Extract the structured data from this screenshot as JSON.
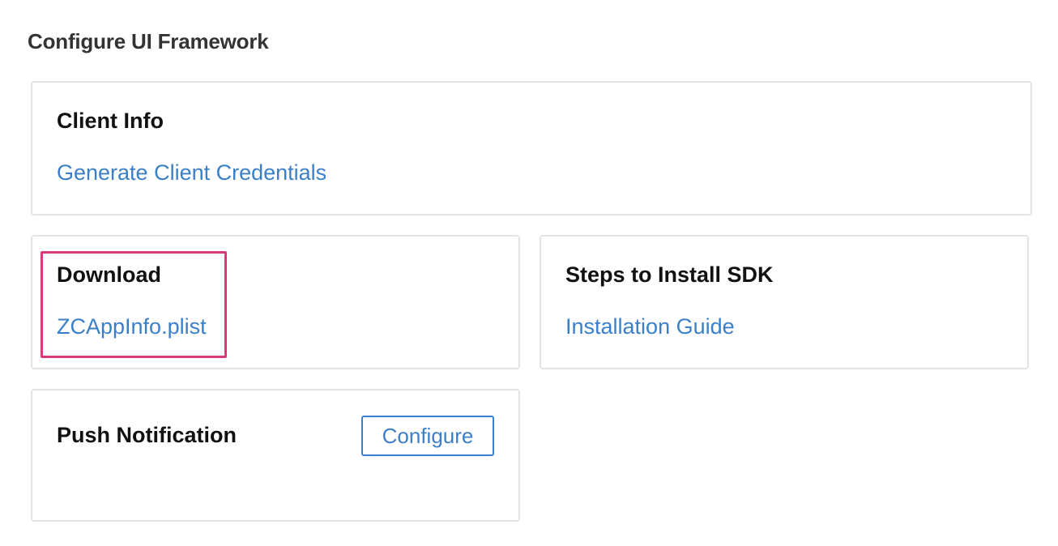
{
  "page": {
    "title": "Configure UI Framework"
  },
  "cards": {
    "client_info": {
      "title": "Client Info",
      "link": "Generate Client Credentials"
    },
    "download": {
      "title": "Download",
      "link": "ZCAppInfo.plist"
    },
    "install_sdk": {
      "title": "Steps to Install SDK",
      "link": "Installation Guide"
    },
    "push_notification": {
      "title": "Push Notification",
      "button_label": "Configure"
    }
  },
  "colors": {
    "link": "#3b7fc9",
    "highlight": "#d63c7a",
    "card_border": "#e3e3e3",
    "title_text": "#333333"
  }
}
